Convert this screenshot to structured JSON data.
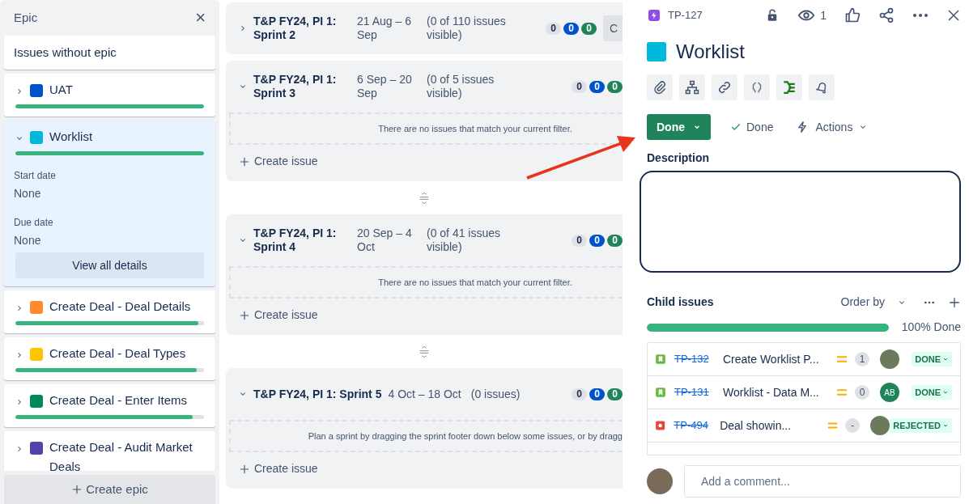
{
  "epic_panel": {
    "title": "Epic",
    "close": "×",
    "items": [
      {
        "kind": "plain",
        "name": "Issues without epic"
      },
      {
        "kind": "epic",
        "name": "UAT",
        "color": "#0052cc",
        "expanded": false,
        "level": 1
      },
      {
        "kind": "epic",
        "name": "Worklist",
        "color": "#00b8d9",
        "expanded": true,
        "level": 1,
        "details": [
          {
            "label": "Start date",
            "value": "None"
          },
          {
            "label": "Due date",
            "value": "None"
          }
        ],
        "details_button": "View all details"
      },
      {
        "kind": "epic",
        "name": "Create Deal - Deal Details",
        "color": "#ff8b2e",
        "expanded": false,
        "level": 0.97
      },
      {
        "kind": "epic",
        "name": "Create Deal - Deal Types",
        "color": "#ffc400",
        "expanded": false,
        "level": 0.96
      },
      {
        "kind": "epic",
        "name": "Create Deal - Enter Items",
        "color": "#00875a",
        "expanded": false,
        "level": 0.94
      },
      {
        "kind": "epic",
        "name": "Create Deal - Audit Market Deals",
        "color": "#5243aa",
        "expanded": false
      }
    ],
    "create_button": "Create epic"
  },
  "sprints": [
    {
      "kind": "stacked",
      "title": "T&P FY24, PI 1: Sprint 2",
      "dates": "21 Aug – 6 Sep",
      "count": "(0 of 110 issues visible)",
      "expanded": false,
      "badges": [
        "0",
        "0",
        "0"
      ],
      "action": "C"
    },
    {
      "kind": "stacked",
      "title": "T&P FY24, PI 1: Sprint 3",
      "dates": "6 Sep – 20 Sep",
      "count": "(0 of 5 issues visible)",
      "expanded": true,
      "badges": [
        "0",
        "0",
        "0"
      ],
      "message": "There are no issues that match your current filter.",
      "create_issue": "Create issue"
    },
    {
      "kind": "stacked",
      "title": "T&P FY24, PI 1: Sprint 4",
      "dates": "20 Sep – 4 Oct",
      "count": "(0 of 41 issues visible)",
      "expanded": true,
      "badges": [
        "0",
        "0",
        "0"
      ],
      "message": "There are no issues that match your current filter.",
      "create_issue": "Create issue"
    },
    {
      "kind": "inline",
      "title": "T&P FY24, PI 1: Sprint 5",
      "dates": "4 Oct – 18 Oct",
      "count": "(0 issues)",
      "expanded": true,
      "badges": [
        "0",
        "0",
        "0"
      ],
      "message": "Plan a sprint by dragging the sprint footer down below some issues, or by dragg",
      "create_issue": "Create issue"
    }
  ],
  "issue": {
    "key": "TP-127",
    "watchers": "1",
    "title": "Worklist",
    "color": "#00b8d9",
    "status_button": "Done",
    "resolution": "Done",
    "actions": "Actions",
    "description_label": "Description",
    "child_issues": {
      "label": "Child issues",
      "order_by": "Order by",
      "level": 1,
      "progress_text": "100% Done",
      "rows": [
        {
          "kind": "story",
          "key": "TP-132",
          "summary": "Create Worklist P...",
          "count": "1",
          "status": "DONE"
        },
        {
          "kind": "story",
          "key": "TP-131",
          "summary": "Worklist - Data M...",
          "count": "0",
          "assignee_initials": "AB",
          "status": "DONE"
        },
        {
          "kind": "bug",
          "key": "TP-494",
          "summary": "Deal showin...",
          "count": "-",
          "status": "REJECTED"
        }
      ]
    },
    "comment_placeholder": "Add a comment..."
  }
}
